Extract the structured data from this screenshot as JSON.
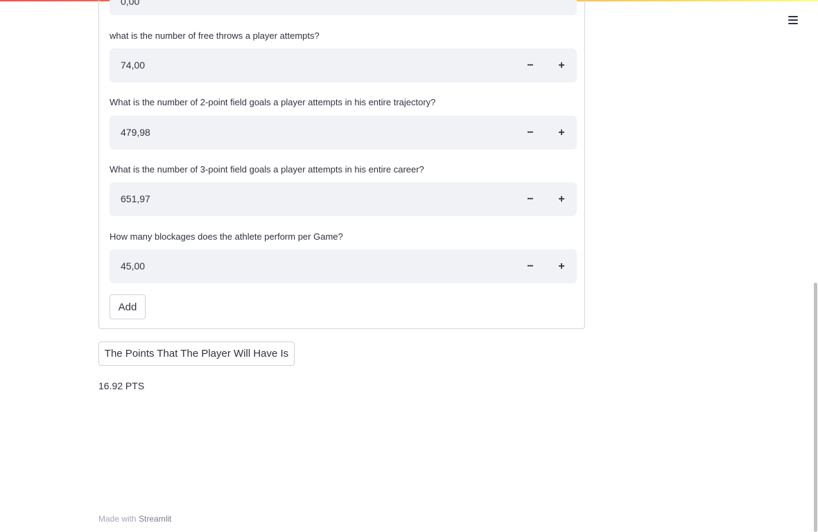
{
  "top_input": {
    "value": "0,00"
  },
  "fields": [
    {
      "label": "what is the number of free throws a player attempts?",
      "value": "74,00"
    },
    {
      "label": "What is the number of 2-point field goals a player attempts in his entire trajectory?",
      "value": "479,98"
    },
    {
      "label": "What is the number of 3-point field goals a player attempts in his entire career?",
      "value": "651,97"
    },
    {
      "label": "How many blockages does the athlete perform per Game?",
      "value": "45,00"
    }
  ],
  "stepper": {
    "minus": "−",
    "plus": "+"
  },
  "add_button": "Add",
  "points_button": "The Points That The Player Will Have Is",
  "result": "16.92 PTS",
  "footer": {
    "prefix": "Made with",
    "brand": "Streamlit"
  },
  "colors": {
    "accent": "#ff4b4b",
    "input_bg": "#f0f2f6",
    "text": "#31333f"
  }
}
